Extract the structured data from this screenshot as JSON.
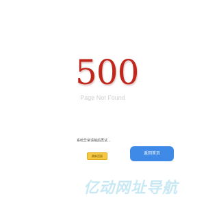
{
  "error": {
    "code": "500",
    "subtitle": "Page Not Found",
    "message": "系统异常请稍后再试..."
  },
  "actions": {
    "refresh_label": "刷新页面",
    "home_label": "返回首页"
  },
  "watermark": {
    "text": "亿动网址导航"
  },
  "colors": {
    "error_code": "#c0281e",
    "subtitle": "#cfcfcf",
    "refresh_button": "#f5c842",
    "home_button": "#3f8ae6",
    "watermark": "#c8e8f4"
  }
}
